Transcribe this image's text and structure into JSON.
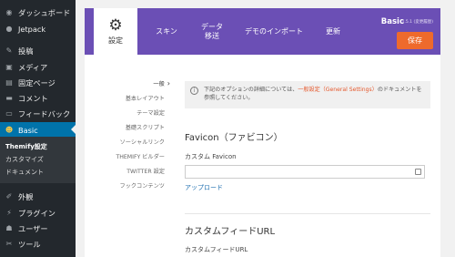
{
  "admin_menu": {
    "items": [
      {
        "label": "ダッシュボード",
        "icon": "dashboard-icon"
      },
      {
        "label": "Jetpack",
        "icon": "jetpack-icon"
      },
      {
        "label": "投稿",
        "icon": "pin-icon"
      },
      {
        "label": "メディア",
        "icon": "media-icon"
      },
      {
        "label": "固定ページ",
        "icon": "pages-icon"
      },
      {
        "label": "コメント",
        "icon": "comment-icon"
      },
      {
        "label": "フィードバック",
        "icon": "feedback-icon"
      },
      {
        "label": "Basic",
        "icon": "themify-icon"
      },
      {
        "label": "外観",
        "icon": "brush-icon"
      },
      {
        "label": "プラグイン",
        "icon": "plugin-icon"
      },
      {
        "label": "ユーザー",
        "icon": "user-icon"
      },
      {
        "label": "ツール",
        "icon": "wrench-icon"
      }
    ],
    "submenu": [
      "Themify設定",
      "カスタマイズ",
      "ドキュメント"
    ]
  },
  "header": {
    "tabs": [
      "設定",
      "スキン",
      "データ\n移送",
      "デモのインポート",
      "更新"
    ],
    "theme_name": "Basic",
    "theme_version": "1.5.1 (変更履歴)",
    "save_label": "保存"
  },
  "subtabs": [
    "一般",
    "基本レイアウト",
    "テーマ設定",
    "基礎スクリプト",
    "ソーシャルリンク",
    "THEMIFY ビルダー",
    "TWITTER 設定",
    "フックコンテンツ"
  ],
  "notice": {
    "prefix": "下記のオプションの詳細については、",
    "link": "一般設定（General Settings）",
    "suffix": "のドキュメントを参照してください。"
  },
  "favicon": {
    "section_title": "Favicon（ファビコン）",
    "label": "カスタム Favicon",
    "upload": "アップロード"
  },
  "feed": {
    "section_title": "カスタムフィードURL",
    "label": "カスタムフィードURL"
  },
  "colors": {
    "accent": "#6b4fb5",
    "save": "#ee6a2c",
    "wp_current": "#0073aa",
    "sidebar": "#23282d"
  }
}
